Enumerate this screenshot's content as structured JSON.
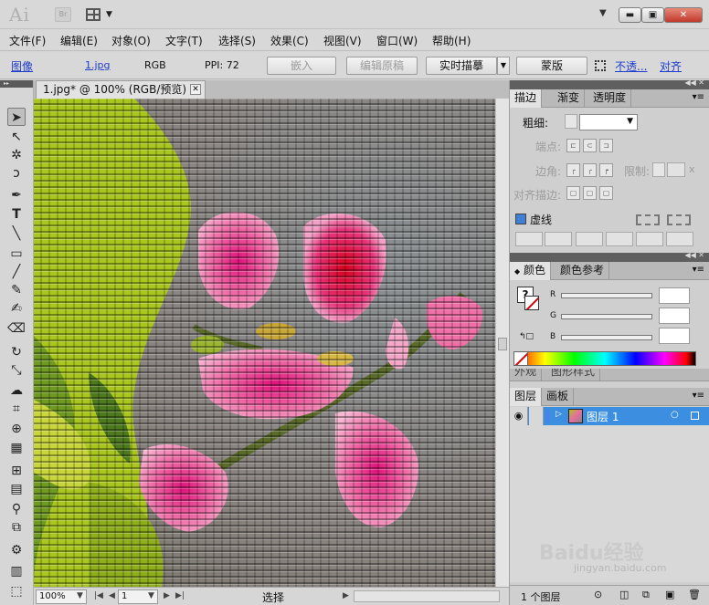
{
  "titlebar": {
    "app_logo": "Ai",
    "bridge": "Br",
    "window_controls": {
      "minimize": "▬",
      "maximize": "▣",
      "close": "✕"
    }
  },
  "menu": [
    "文件(F)",
    "编辑(E)",
    "对象(O)",
    "文字(T)",
    "选择(S)",
    "效果(C)",
    "视图(V)",
    "窗口(W)",
    "帮助(H)"
  ],
  "control_bar": {
    "object_type": "图像",
    "file_name": "1.jpg",
    "color_mode": "RGB",
    "ppi": "PPI: 72",
    "embed": "嵌入",
    "edit_original": "编辑原稿",
    "live_trace": "实时描摹",
    "mask": "蒙版",
    "opacity": "不透...",
    "align": "对齐"
  },
  "document": {
    "tab_title": "1.jpg* @ 100% (RGB/预览)"
  },
  "status_bar": {
    "zoom": "100%",
    "artboard": "1",
    "current_tool": "选择"
  },
  "stroke_panel": {
    "tabs": [
      "描边",
      "渐变",
      "透明度"
    ],
    "weight_label": "粗细:",
    "cap_label": "端点:",
    "corner_label": "边角:",
    "limit_label": "限制:",
    "limit_unit": "x",
    "align_label": "对齐描边:",
    "dashed_label": "虚线"
  },
  "color_panel": {
    "tabs": [
      "颜色",
      "颜色参考"
    ],
    "channels": [
      "R",
      "G",
      "B"
    ],
    "partial_tabs": [
      "外观",
      "图形样式"
    ]
  },
  "layers_panel": {
    "tabs": [
      "图层",
      "画板"
    ],
    "layers": [
      {
        "name": "图层 1"
      }
    ],
    "footer": "1 个图层"
  },
  "watermark": {
    "logo": "Baidu经验",
    "url": "jingyan.baidu.com"
  }
}
